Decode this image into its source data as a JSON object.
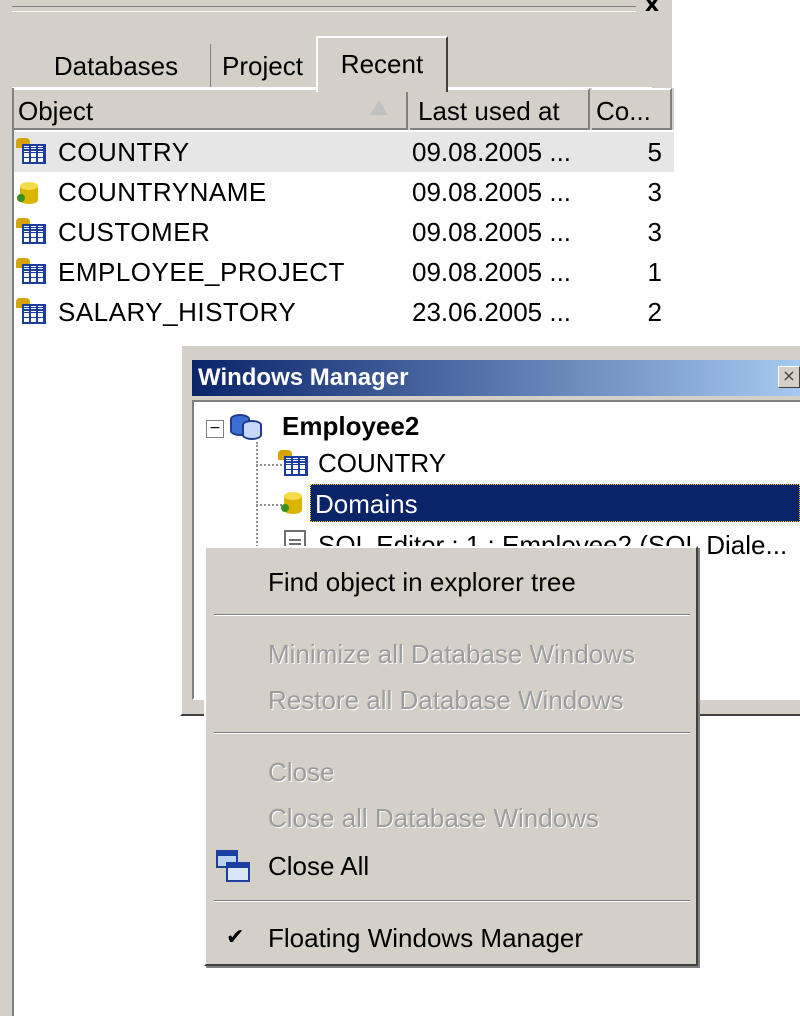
{
  "panel": {
    "close_glyph": "x",
    "tabs": [
      {
        "label": "Databases"
      },
      {
        "label": "Project"
      },
      {
        "label": "Recent"
      }
    ],
    "columns": [
      "Object",
      "Last used at",
      "Co..."
    ],
    "rows": [
      {
        "name": "COUNTRY",
        "last_used": "09.08.2005 ...",
        "count": "5",
        "icon": "table-icon",
        "selected": true
      },
      {
        "name": "COUNTRYNAME",
        "last_used": "09.08.2005 ...",
        "count": "3",
        "icon": "domain-icon",
        "selected": false
      },
      {
        "name": "CUSTOMER",
        "last_used": "09.08.2005 ...",
        "count": "3",
        "icon": "table-icon",
        "selected": false
      },
      {
        "name": "EMPLOYEE_PROJECT",
        "last_used": "09.08.2005 ...",
        "count": "1",
        "icon": "table-icon",
        "selected": false
      },
      {
        "name": "SALARY_HISTORY",
        "last_used": "23.06.2005 ...",
        "count": "2",
        "icon": "table-icon",
        "selected": false
      }
    ]
  },
  "windows_manager": {
    "title": "Windows Manager",
    "close_glyph": "×",
    "expander_glyph": "−",
    "root": "Employee2",
    "items": [
      {
        "label": "COUNTRY",
        "icon": "table-icon"
      },
      {
        "label": "Domains",
        "icon": "domain-icon",
        "selected": true
      },
      {
        "label": "SQL Editor : 1 : Employee2 (SQL Diale...",
        "icon": "document-icon"
      }
    ]
  },
  "context_menu": {
    "items": [
      {
        "label": "Find object in explorer tree",
        "enabled": true
      },
      {
        "label": "Minimize all Database Windows",
        "enabled": false
      },
      {
        "label": "Restore all Database Windows",
        "enabled": false
      },
      {
        "label": "Close",
        "enabled": false
      },
      {
        "label": "Close all Database Windows",
        "enabled": false
      },
      {
        "label": "Close All",
        "enabled": true,
        "icon": "close-all-windows-icon"
      },
      {
        "label": "Floating Windows Manager",
        "enabled": true,
        "checked": true
      }
    ],
    "check_glyph": "✔"
  },
  "colors": {
    "title_gradient_start": "#0a246a",
    "title_gradient_end": "#a6caf0",
    "selection": "#0a246a",
    "face": "#d4d0c8",
    "disabled_text": "#9c9c9c"
  }
}
